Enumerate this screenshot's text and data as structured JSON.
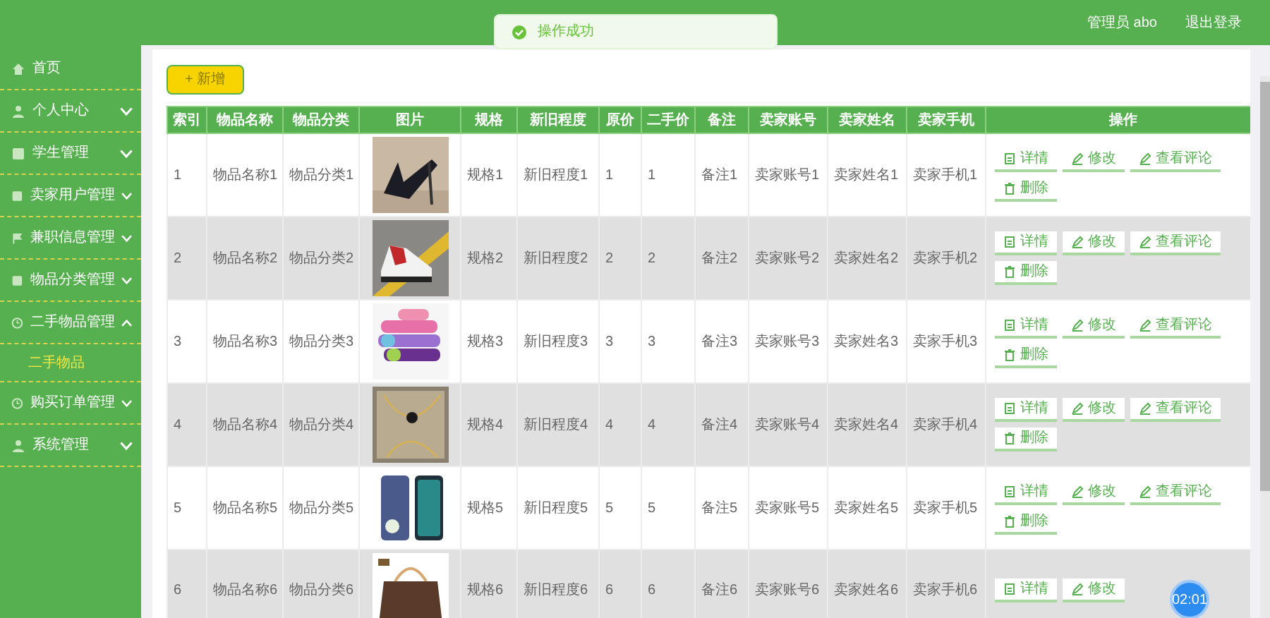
{
  "header": {
    "user": "管理员 abo",
    "logout": "退出登录"
  },
  "toast": {
    "message": "操作成功"
  },
  "sidebar": {
    "items": [
      {
        "label": "首页",
        "kind": "home"
      },
      {
        "label": "个人中心",
        "kind": "user",
        "expanded": false
      },
      {
        "label": "学生管理",
        "kind": "grid",
        "expanded": false
      },
      {
        "label": "卖家用户管理",
        "kind": "grid",
        "expanded": false
      },
      {
        "label": "兼职信息管理",
        "kind": "flag",
        "expanded": false
      },
      {
        "label": "物品分类管理",
        "kind": "grid",
        "expanded": false
      },
      {
        "label": "二手物品管理",
        "kind": "clock",
        "expanded": true,
        "children": [
          {
            "label": "二手物品",
            "selected": true
          }
        ]
      },
      {
        "label": "购买订单管理",
        "kind": "clock",
        "expanded": false
      },
      {
        "label": "系统管理",
        "kind": "user",
        "expanded": false
      }
    ]
  },
  "add_button": "+ 新增",
  "table": {
    "columns": [
      "索引",
      "物品名称",
      "物品分类",
      "图片",
      "规格",
      "新旧程度",
      "原价",
      "二手价",
      "备注",
      "卖家账号",
      "卖家姓名",
      "卖家手机",
      "操作"
    ],
    "rows": [
      {
        "cells": [
          "1",
          "物品名称1",
          "物品分类1",
          {
            "kind": "picture"
          },
          "规格1",
          "新旧程度1",
          "1",
          "1",
          "备注1",
          "卖家账号1",
          "卖家姓名1",
          "卖家手机1"
        ],
        "actions": [
          {
            "label": "详情",
            "kind": "doc"
          },
          {
            "label": "修改",
            "kind": "edit"
          },
          {
            "label": "查看评论",
            "kind": "edit"
          },
          {
            "label": "删除",
            "kind": "trash"
          }
        ]
      },
      {
        "cells": [
          "2",
          "物品名称2",
          "物品分类2",
          {
            "kind": "picture"
          },
          "规格2",
          "新旧程度2",
          "2",
          "2",
          "备注2",
          "卖家账号2",
          "卖家姓名2",
          "卖家手机2"
        ],
        "actions": [
          {
            "label": "详情",
            "kind": "doc"
          },
          {
            "label": "修改",
            "kind": "edit"
          },
          {
            "label": "查看评论",
            "kind": "edit"
          },
          {
            "label": "删除",
            "kind": "trash"
          }
        ]
      },
      {
        "cells": [
          "3",
          "物品名称3",
          "物品分类3",
          {
            "kind": "picture"
          },
          "规格3",
          "新旧程度3",
          "3",
          "3",
          "备注3",
          "卖家账号3",
          "卖家姓名3",
          "卖家手机3"
        ],
        "actions": [
          {
            "label": "详情",
            "kind": "doc"
          },
          {
            "label": "修改",
            "kind": "edit"
          },
          {
            "label": "查看评论",
            "kind": "edit"
          },
          {
            "label": "删除",
            "kind": "trash"
          }
        ]
      },
      {
        "cells": [
          "4",
          "物品名称4",
          "物品分类4",
          {
            "kind": "picture"
          },
          "规格4",
          "新旧程度4",
          "4",
          "4",
          "备注4",
          "卖家账号4",
          "卖家姓名4",
          "卖家手机4"
        ],
        "actions": [
          {
            "label": "详情",
            "kind": "doc"
          },
          {
            "label": "修改",
            "kind": "edit"
          },
          {
            "label": "查看评论",
            "kind": "edit"
          },
          {
            "label": "删除",
            "kind": "trash"
          }
        ]
      },
      {
        "cells": [
          "5",
          "物品名称5",
          "物品分类5",
          {
            "kind": "picture"
          },
          "规格5",
          "新旧程度5",
          "5",
          "5",
          "备注5",
          "卖家账号5",
          "卖家姓名5",
          "卖家手机5"
        ],
        "actions": [
          {
            "label": "详情",
            "kind": "doc"
          },
          {
            "label": "修改",
            "kind": "edit"
          },
          {
            "label": "查看评论",
            "kind": "edit"
          },
          {
            "label": "删除",
            "kind": "trash"
          }
        ]
      },
      {
        "cells": [
          "6",
          "物品名称6",
          "物品分类6",
          {
            "kind": "picture"
          },
          "规格6",
          "新旧程度6",
          "6",
          "6",
          "备注6",
          "卖家账号6",
          "卖家姓名6",
          "卖家手机6"
        ],
        "actions": [
          {
            "label": "详情",
            "kind": "doc"
          },
          {
            "label": "修改",
            "kind": "edit"
          }
        ]
      }
    ]
  },
  "timer": "02:01"
}
